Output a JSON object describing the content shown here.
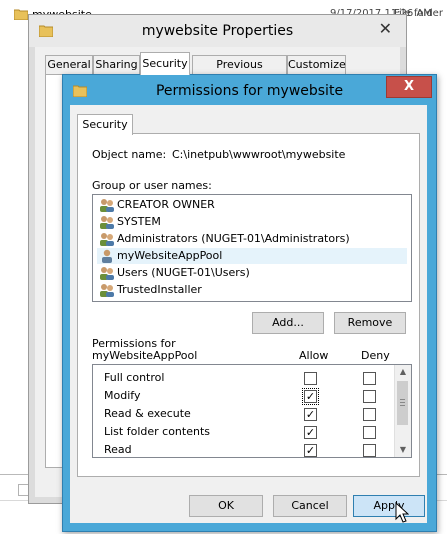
{
  "explorer_row": {
    "name": "mywebsite",
    "date": "9/17/2017 11:26 AM",
    "type": "File folder"
  },
  "properties": {
    "title": "mywebsite Properties",
    "tabs": [
      "General",
      "Sharing",
      "Security",
      "Previous Versions",
      "Customize"
    ],
    "active_tab": "Security"
  },
  "permissions": {
    "title": "Permissions for mywebsite",
    "tab": "Security",
    "object_label": "Object name:",
    "object_value": "C:\\inetpub\\wwwroot\\mywebsite",
    "group_label": "Group or user names:",
    "users": [
      {
        "name": "CREATOR OWNER",
        "icon": "users-group-icon"
      },
      {
        "name": "SYSTEM",
        "icon": "users-group-icon"
      },
      {
        "name": "Administrators (NUGET-01\\Administrators)",
        "icon": "users-group-icon"
      },
      {
        "name": "myWebsiteAppPool",
        "icon": "user-icon",
        "selected": true
      },
      {
        "name": "Users (NUGET-01\\Users)",
        "icon": "users-group-icon"
      },
      {
        "name": "TrustedInstaller",
        "icon": "users-group-icon"
      }
    ],
    "add_label": "Add...",
    "remove_label": "Remove",
    "permissions_for_label_line1": "Permissions for",
    "permissions_for_label_line2": "myWebsiteAppPool",
    "allow_header": "Allow",
    "deny_header": "Deny",
    "rows": [
      {
        "name": "Full control",
        "allow": false,
        "deny": false
      },
      {
        "name": "Modify",
        "allow": true,
        "deny": false
      },
      {
        "name": "Read & execute",
        "allow": true,
        "deny": false
      },
      {
        "name": "List folder contents",
        "allow": true,
        "deny": false
      },
      {
        "name": "Read",
        "allow": true,
        "deny": false
      }
    ],
    "ok_label": "OK",
    "cancel_label": "Cancel",
    "apply_label": "Apply",
    "close_glyph": "X"
  },
  "colors": {
    "dialog_border": "#4aa8d8",
    "close_button": "#c7504a",
    "selection": "#e5f3fb",
    "apply_button": "#cce4f7"
  }
}
